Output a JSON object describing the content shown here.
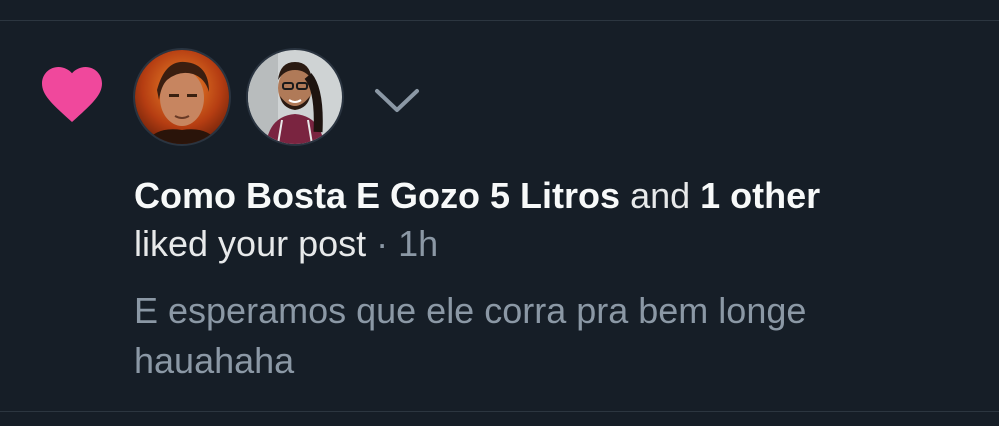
{
  "notification": {
    "type_icon": "heart-icon",
    "heart_color": "#f0489c",
    "avatars": [
      {
        "icon": "avatar-user-1"
      },
      {
        "icon": "avatar-user-2"
      }
    ],
    "expand_icon": "chevron-down-icon",
    "actor_name": "Como Bosta E Gozo 5 Litros",
    "connector": "and",
    "others": "1 other",
    "action": "liked your post",
    "separator": "·",
    "time": "1h",
    "post_snippet": "E esperamos que ele corra pra bem longe hauahaha"
  }
}
